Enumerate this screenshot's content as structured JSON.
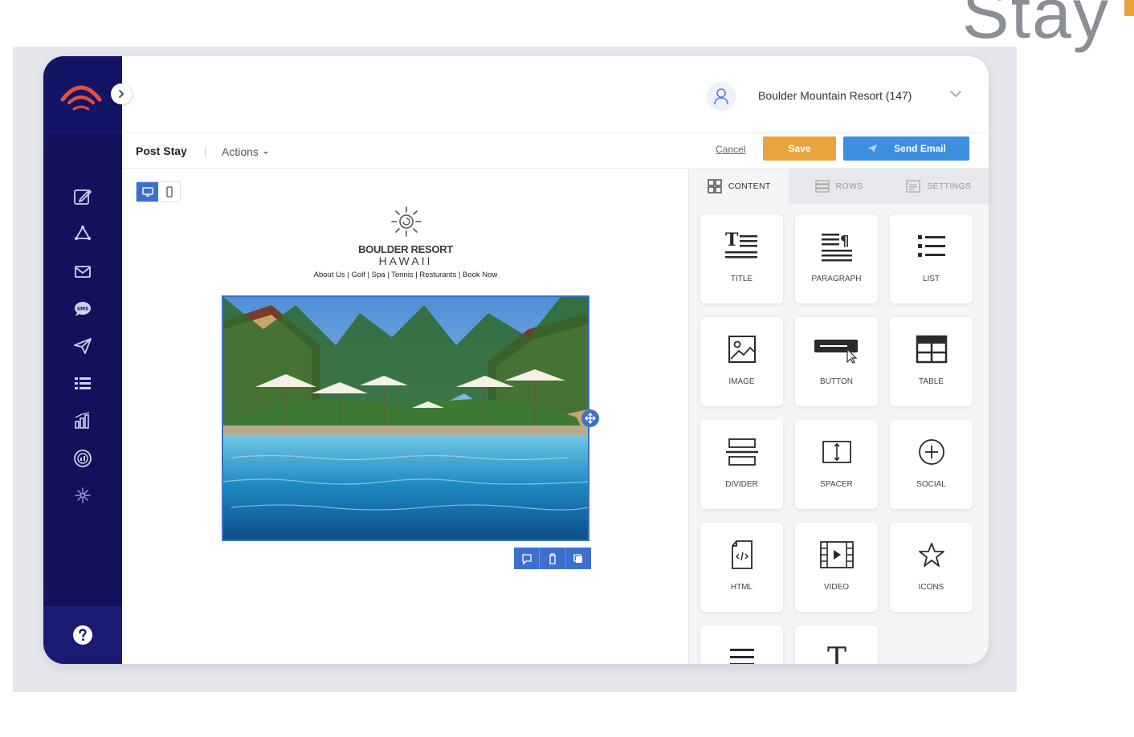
{
  "corner_logo": "Stay",
  "user": {
    "name": "Boulder Mountain Resort (147)"
  },
  "toolbar": {
    "title": "Post Stay",
    "actions_label": "Actions",
    "cancel_label": "Cancel",
    "save_label": "Save",
    "send_label": "Send Email"
  },
  "email": {
    "brand_line1": "BOULDER RESORT",
    "brand_line2": "HAWAII",
    "nav": "About Us | Golf | Spa | Tennis | Resturants | Book Now"
  },
  "panel": {
    "tabs": [
      {
        "label": "CONTENT",
        "icon": "grid-icon"
      },
      {
        "label": "ROWS",
        "icon": "rows-icon"
      },
      {
        "label": "SETTINGS",
        "icon": "settings-icon"
      }
    ],
    "blocks": [
      {
        "label": "TITLE",
        "icon": "title-icon"
      },
      {
        "label": "PARAGRAPH",
        "icon": "paragraph-icon"
      },
      {
        "label": "LIST",
        "icon": "list-icon"
      },
      {
        "label": "IMAGE",
        "icon": "image-icon"
      },
      {
        "label": "BUTTON",
        "icon": "button-icon"
      },
      {
        "label": "TABLE",
        "icon": "table-icon"
      },
      {
        "label": "DIVIDER",
        "icon": "divider-icon"
      },
      {
        "label": "SPACER",
        "icon": "spacer-icon"
      },
      {
        "label": "SOCIAL",
        "icon": "social-icon"
      },
      {
        "label": "HTML",
        "icon": "html-icon"
      },
      {
        "label": "VIDEO",
        "icon": "video-icon"
      },
      {
        "label": "ICONS",
        "icon": "star-icon"
      },
      {
        "label": "",
        "icon": "menu-icon"
      },
      {
        "label": "",
        "icon": "text-icon"
      }
    ]
  },
  "colors": {
    "sidebar": "#12125c",
    "accent_blue": "#3d6fd0",
    "save": "#e9a43f",
    "send": "#3d8ee0",
    "brand_red": "#e4513a"
  }
}
